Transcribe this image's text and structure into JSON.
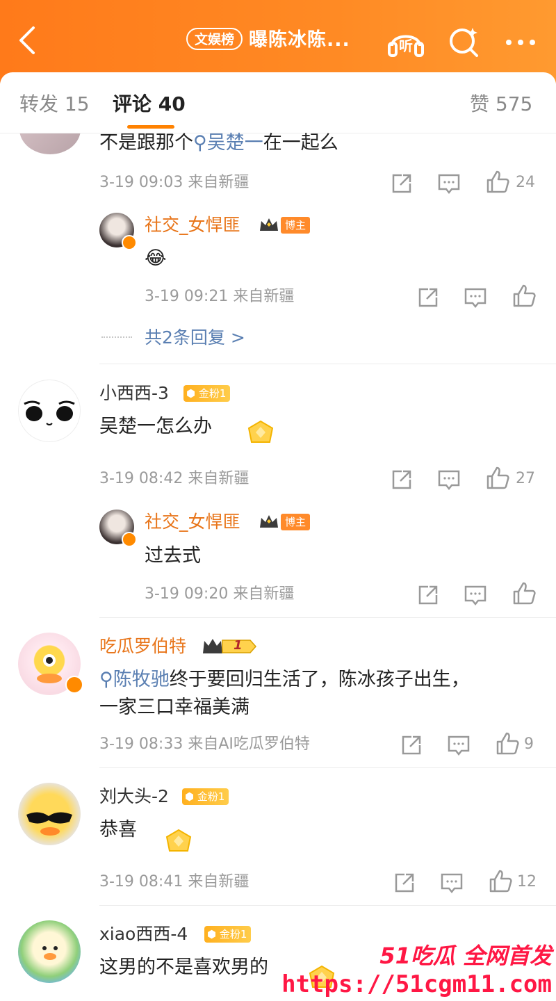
{
  "header": {
    "tag": "文娱榜",
    "title": "曝陈冰陈...",
    "listen_label": "听"
  },
  "tabs": {
    "repost": "转发 15",
    "comment": "评论 40",
    "like": "赞 575"
  },
  "comments": [
    {
      "text": "不是跟那个",
      "mention": "吴楚一",
      "text_after": "在一起么",
      "meta": "3-19 09:03 来自新疆",
      "likes": "24",
      "reply": {
        "name": "社交_女悍匪",
        "badge": "博主",
        "text": "😂",
        "meta": "3-19 09:21 来自新疆"
      },
      "more_replies": "共2条回复 >"
    },
    {
      "name": "小西西-3",
      "fan_badge": "金粉1",
      "text": "吴楚一怎么办",
      "meta": "3-19 08:42 来自新疆",
      "likes": "27",
      "reply": {
        "name": "社交_女悍匪",
        "badge": "博主",
        "text": "过去式",
        "meta": "3-19 09:20 来自新疆"
      }
    },
    {
      "name": "吃瓜罗伯特",
      "level": "1",
      "mention": "陈牧驰",
      "text_line1": "终于要回归生活了，陈冰孩子出生，",
      "text_line2": "一家三口幸福美满",
      "meta": "3-19 08:33 来自AI吃瓜罗伯特",
      "likes": "9"
    },
    {
      "name": "刘大头-2",
      "fan_badge": "金粉1",
      "text": "恭喜",
      "meta": "3-19 08:41 来自新疆",
      "likes": "12"
    },
    {
      "name": "xiao西西-4",
      "fan_badge": "金粉1",
      "text": "这男的不是喜欢男的"
    }
  ],
  "watermark": {
    "line1": "51吃瓜 全网首发",
    "line2": "https://51cgm11.com"
  },
  "colors": {
    "accent": "#ff8200",
    "link": "#5a7fb2",
    "vip_name": "#e8751a"
  }
}
